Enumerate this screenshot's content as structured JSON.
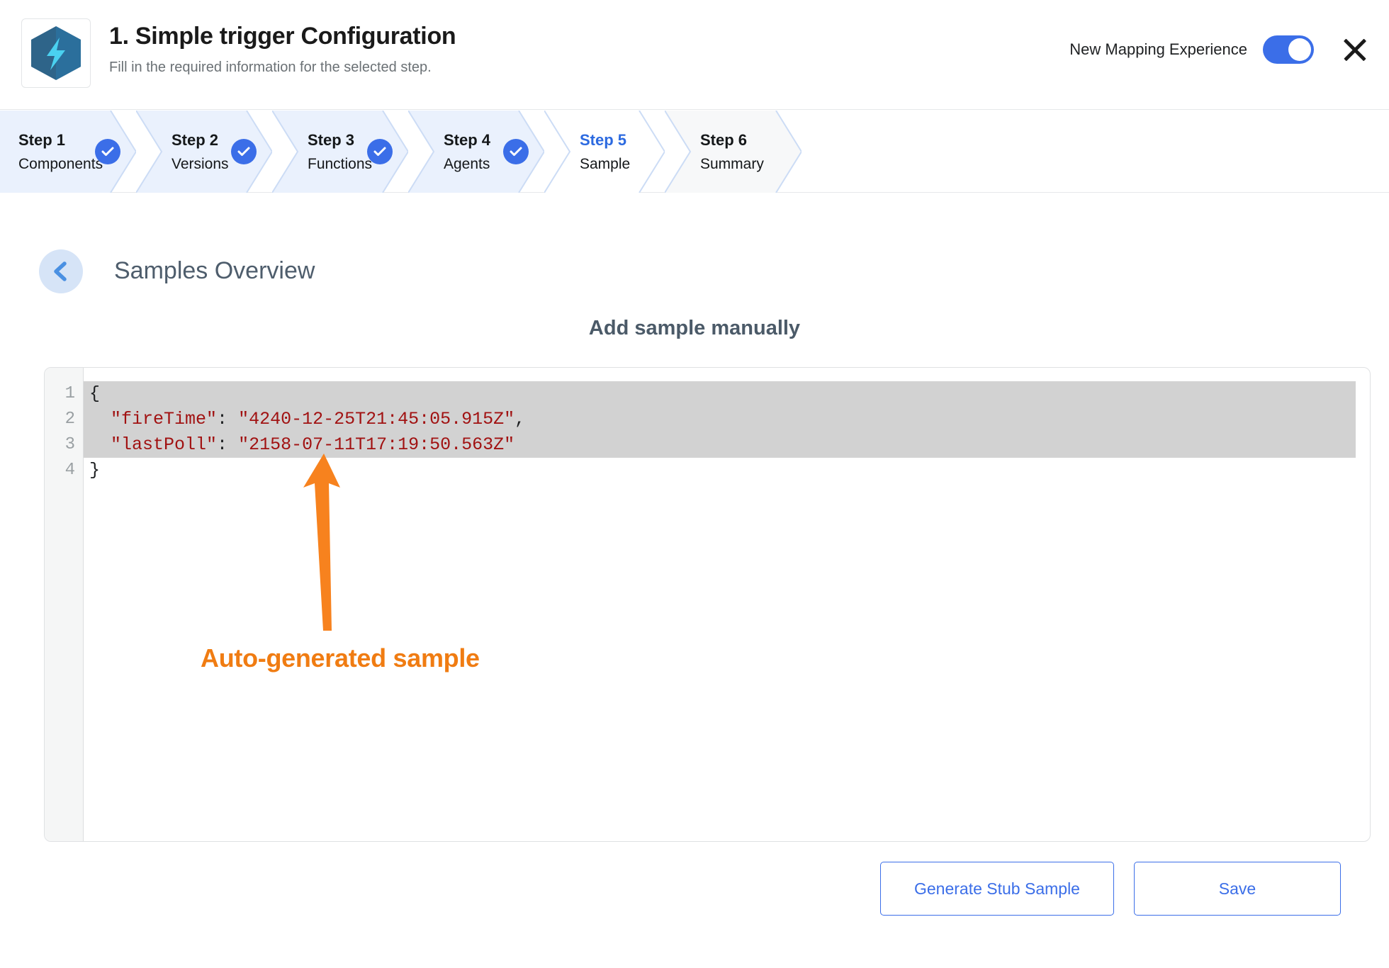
{
  "header": {
    "title": "1. Simple trigger Configuration",
    "subtitle": "Fill in the required information for the selected step.",
    "app_icon": "lightning-hexagon-icon",
    "toggle_label": "New Mapping Experience",
    "toggle_state": "on",
    "close_icon": "close-icon"
  },
  "stepper": {
    "steps": [
      {
        "num": "Step 1",
        "name": "Components",
        "state": "complete"
      },
      {
        "num": "Step 2",
        "name": "Versions",
        "state": "complete"
      },
      {
        "num": "Step 3",
        "name": "Functions",
        "state": "complete"
      },
      {
        "num": "Step 4",
        "name": "Agents",
        "state": "complete"
      },
      {
        "num": "Step 5",
        "name": "Sample",
        "state": "active"
      },
      {
        "num": "Step 6",
        "name": "Summary",
        "state": "upcoming"
      }
    ]
  },
  "section": {
    "back_icon": "chevron-left-icon",
    "title": "Samples Overview",
    "panel_heading": "Add sample manually"
  },
  "editor": {
    "line_numbers": [
      "1",
      "2",
      "3",
      "4"
    ],
    "lines": [
      {
        "indent": "",
        "key": "",
        "value": "",
        "raw": "{",
        "selected": true
      },
      {
        "indent": "  ",
        "key": "\"fireTime\"",
        "value": "\"4240-12-25T21:45:05.915Z\"",
        "trailing": ",",
        "selected": true
      },
      {
        "indent": "  ",
        "key": "\"lastPoll\"",
        "value": "\"2158-07-11T17:19:50.563Z\"",
        "trailing": "",
        "selected": true
      },
      {
        "indent": "",
        "key": "",
        "value": "",
        "raw": "}",
        "selected": false
      }
    ],
    "json_sample": {
      "fireTime": "4240-12-25T21:45:05.915Z",
      "lastPoll": "2158-07-11T17:19:50.563Z"
    }
  },
  "annotation": {
    "text": "Auto-generated sample",
    "color": "#f07c12",
    "arrow_icon": "up-arrow-icon"
  },
  "footer": {
    "generate_label": "Generate Stub Sample",
    "save_label": "Save"
  },
  "colors": {
    "accent_blue": "#3b6ee8",
    "step_complete_bg": "#eaf1fd",
    "step_upcoming_bg": "#f7f8f9",
    "selection_gray": "#d2d2d2",
    "string_red": "#a11212",
    "annotation_orange": "#f07c12"
  }
}
